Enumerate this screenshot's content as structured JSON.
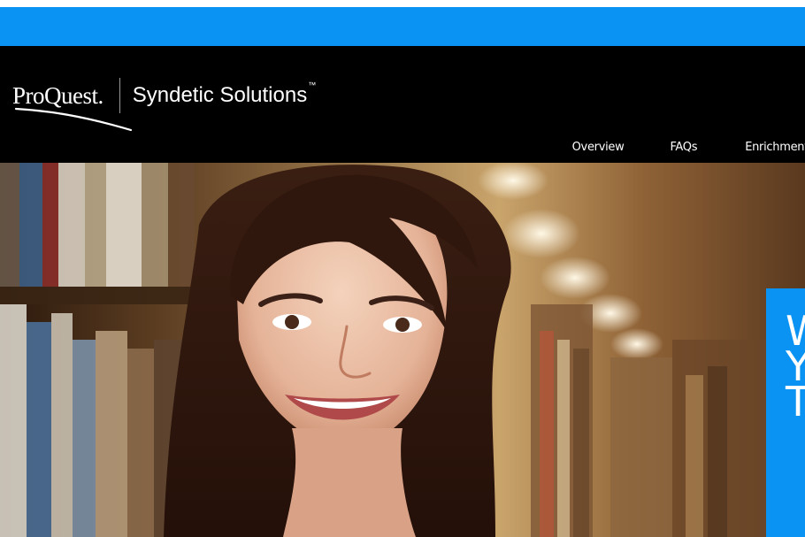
{
  "header": {
    "brand": "ProQuest.",
    "product": "Syndetic Solutions",
    "trademark": "™"
  },
  "nav": {
    "items": [
      {
        "label": "Overview"
      },
      {
        "label": "FAQs"
      },
      {
        "label": "Enrichment"
      }
    ]
  },
  "promo": {
    "lines": [
      "W",
      "Y",
      "T"
    ]
  },
  "colors": {
    "accent_blue": "#0a93f2",
    "header_bg": "#000000"
  }
}
